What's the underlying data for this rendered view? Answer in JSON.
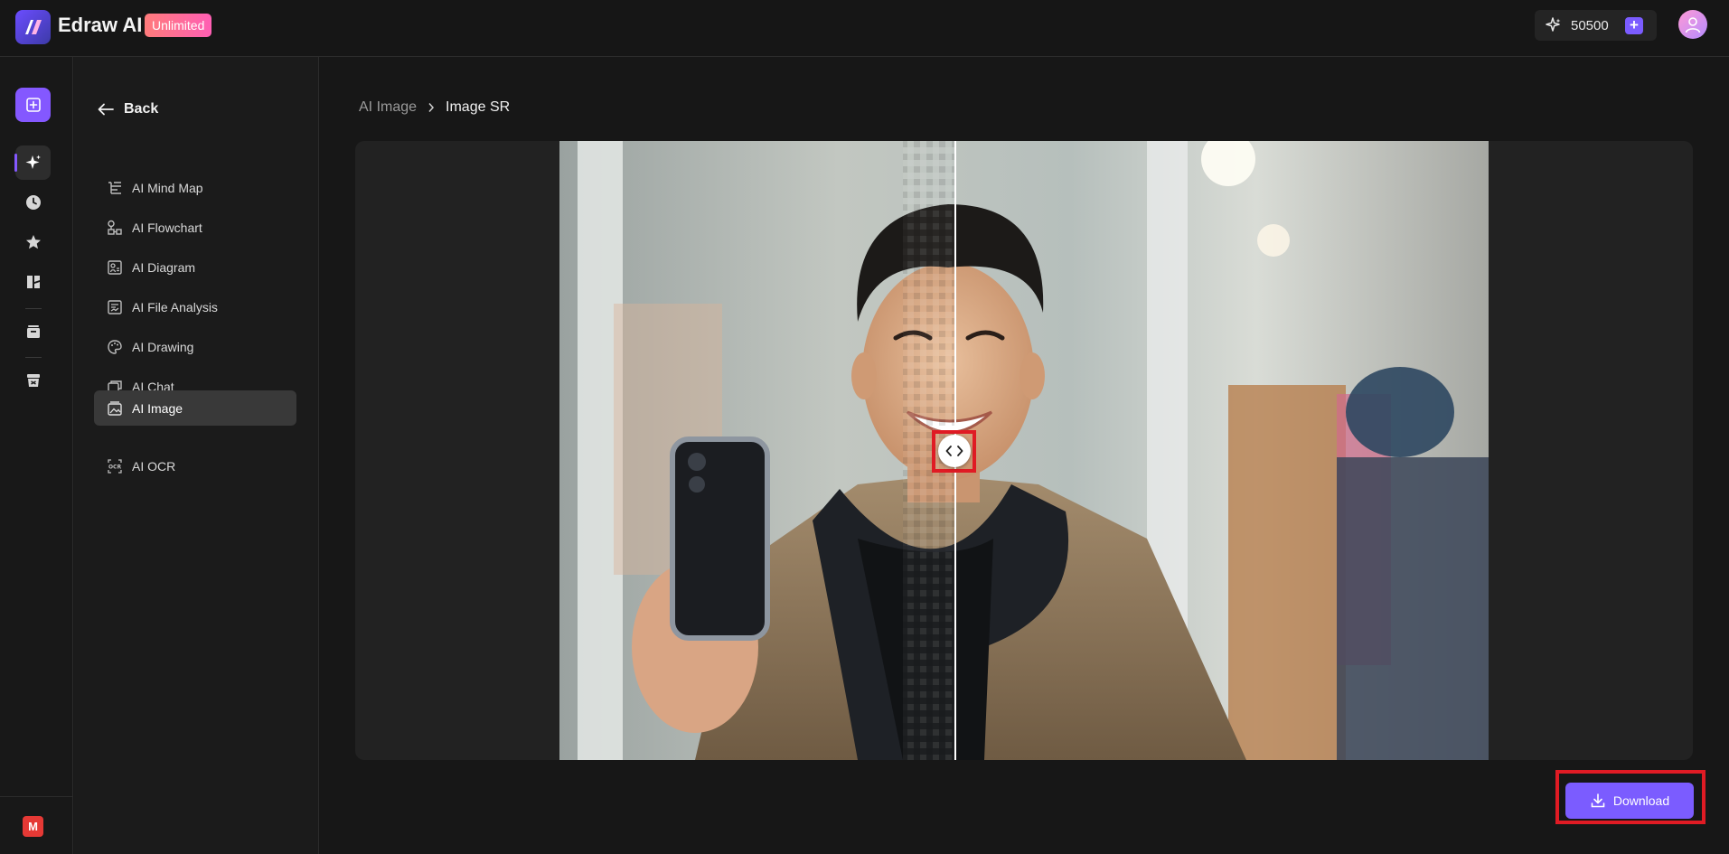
{
  "header": {
    "app_title": "Edraw AI",
    "plan_badge": "Unlimited",
    "credits": "50500",
    "icons": [
      "logo-icon",
      "sparkle-icon",
      "plus-icon",
      "avatar-icon"
    ]
  },
  "rail": {
    "items": [
      "new-file",
      "ai-sparkle",
      "recent",
      "favorites",
      "templates",
      "files",
      "trash"
    ],
    "bottom_badge": "M"
  },
  "menu": {
    "back_label": "Back",
    "items": [
      {
        "label": "AI Mind Map",
        "icon": "mindmap-icon"
      },
      {
        "label": "AI Flowchart",
        "icon": "flowchart-icon"
      },
      {
        "label": "AI Diagram",
        "icon": "diagram-icon"
      },
      {
        "label": "AI File Analysis",
        "icon": "file-analysis-icon"
      },
      {
        "label": "AI Drawing",
        "icon": "palette-icon"
      },
      {
        "label": "AI Chat",
        "icon": "chat-icon"
      },
      {
        "label": "AI Image",
        "icon": "image-icon"
      },
      {
        "label": "AI OCR",
        "icon": "ocr-icon"
      }
    ],
    "active": "AI Image"
  },
  "breadcrumb": {
    "parent": "AI Image",
    "current": "Image SR"
  },
  "actions": {
    "download_label": "Download"
  },
  "colors": {
    "accent": "#7b5cff",
    "highlight": "#e01b24",
    "background": "#171717"
  }
}
